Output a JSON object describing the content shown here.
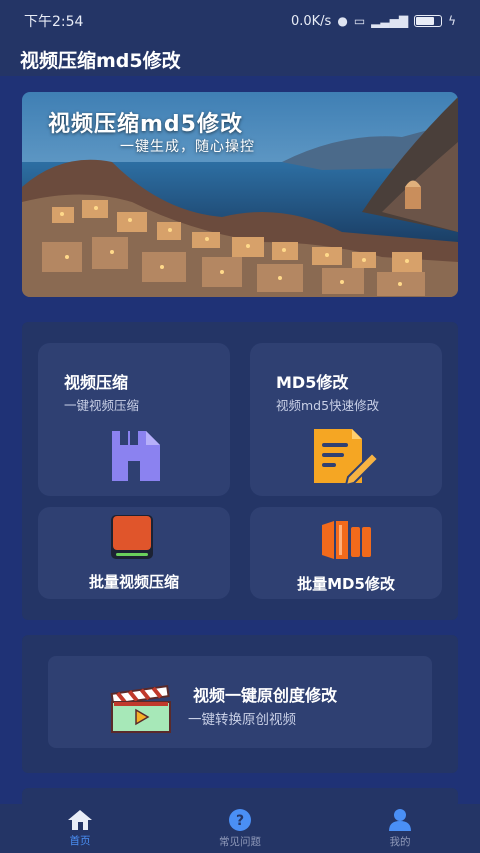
{
  "status_bar": {
    "time": "下午2:54",
    "net_speed": "0.0K/s",
    "battery_level": 0.75
  },
  "app": {
    "title": "视频压缩md5修改"
  },
  "banner": {
    "title": "视频压缩md5修改",
    "subtitle": "一键生成，随心操控"
  },
  "tools": {
    "compress": {
      "title": "视频压缩",
      "subtitle": "一键视频压缩",
      "icon": "save-file-icon"
    },
    "md5": {
      "title": "MD5修改",
      "subtitle": "视频md5快速修改",
      "icon": "edit-document-icon"
    },
    "batch_compress": {
      "label": "批量视频压缩",
      "icon": "book-icon"
    },
    "batch_md5": {
      "label": "批量MD5修改",
      "icon": "column-bars-icon"
    }
  },
  "original": {
    "title": "视频一键原创度修改",
    "subtitle": "一键转换原创视频",
    "icon": "clapperboard-icon"
  },
  "nav": [
    {
      "label": "首页",
      "icon": "home-icon",
      "active": true
    },
    {
      "label": "常见问题",
      "icon": "help-icon",
      "active": false
    },
    {
      "label": "我的",
      "icon": "user-icon",
      "active": false
    }
  ],
  "colors": {
    "background": "#1f3276",
    "panel": "#243566",
    "card": "#2f4072",
    "accent_blue": "#4a8ff5",
    "nav_inactive": "#8e98b8"
  }
}
